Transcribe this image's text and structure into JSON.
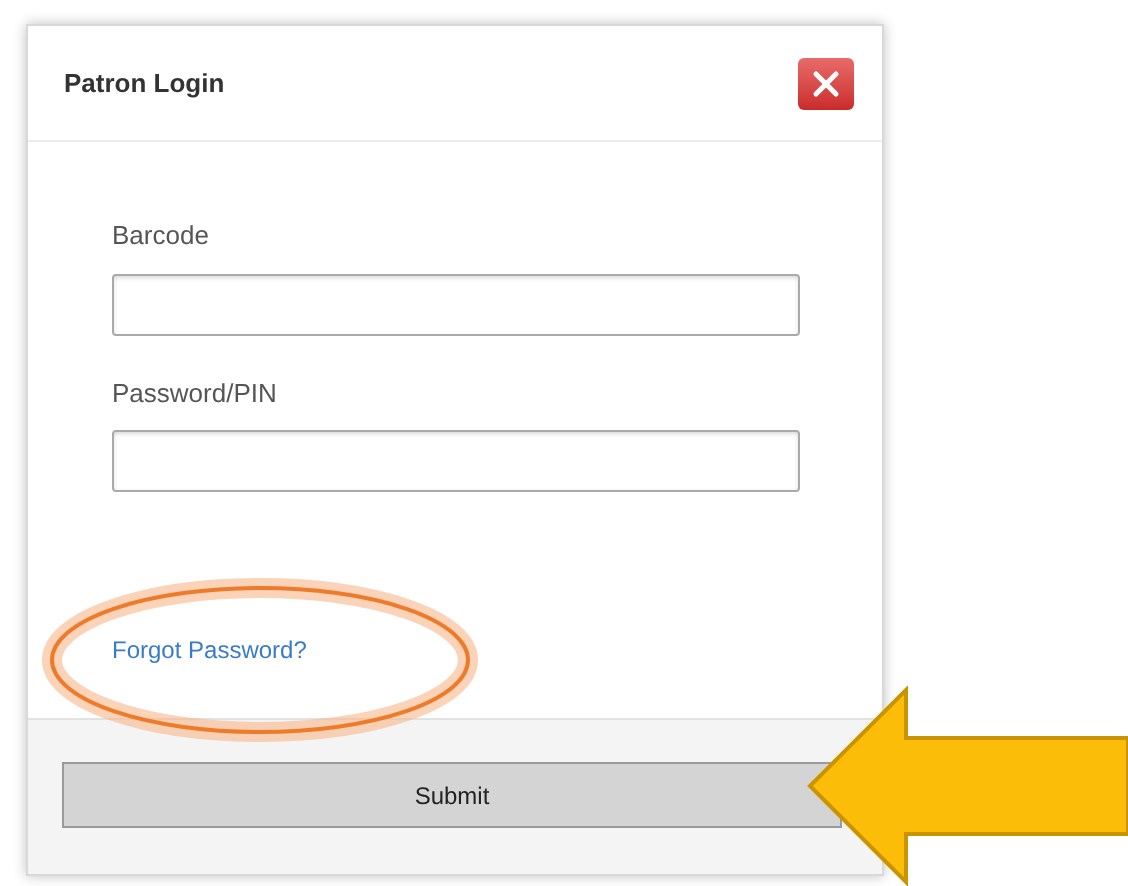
{
  "dialog": {
    "title": "Patron Login"
  },
  "fields": [
    {
      "label": "Barcode"
    },
    {
      "label": "Password/PIN"
    }
  ],
  "forgot_link": "Forgot Password?",
  "submit_button": "Submit"
}
